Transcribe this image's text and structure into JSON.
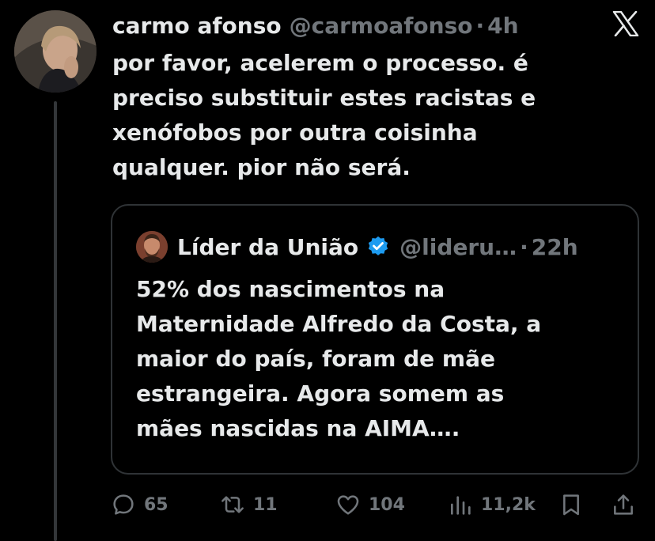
{
  "tweet": {
    "author_name": "carmo afonso",
    "author_handle": "@carmoafonso",
    "separator": "·",
    "time": "4h",
    "text_lines": [
      "por favor, acelerem o processo. é",
      "preciso substituir estes racistas e",
      "xenófobos por outra coisinha",
      "qualquer. pior não será."
    ]
  },
  "quote": {
    "author_name": "Líder da União",
    "author_handle": "@lideru…",
    "separator": "·",
    "time": "22h",
    "verified": true,
    "text_lines": [
      "52% dos nascimentos na",
      "Maternidade Alfredo da Costa, a",
      "maior do país, foram de mãe",
      "estrangeira. Agora somem as",
      "mães nascidas na AIMA…."
    ]
  },
  "actions": {
    "replies": "65",
    "retweets": "11",
    "likes": "104",
    "views": "11,2k"
  },
  "icons": {
    "brand": "x-logo-icon",
    "reply": "reply-icon",
    "retweet": "retweet-icon",
    "like": "heart-icon",
    "views": "views-icon",
    "bookmark": "bookmark-icon",
    "share": "share-icon",
    "verified": "verified-badge-icon"
  },
  "colors": {
    "background": "#000000",
    "text": "#e7e9ea",
    "muted": "#71767b",
    "border": "#2f3336",
    "verified": "#1d9bf0"
  }
}
